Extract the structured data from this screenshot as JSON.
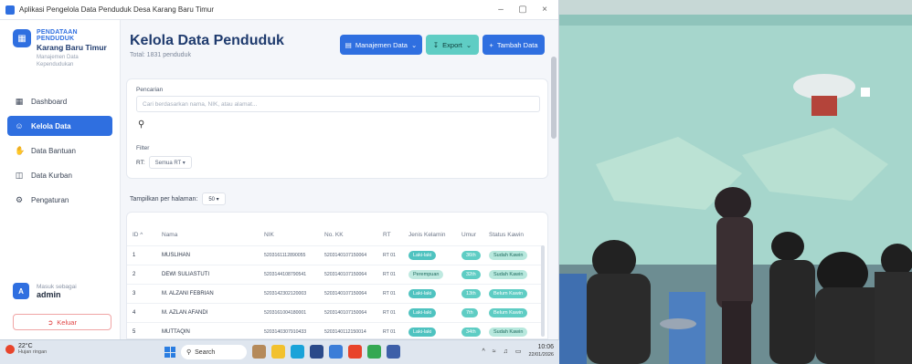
{
  "window": {
    "title": "Aplikasi Pengelola Data Penduduk Desa Karang Baru Timur",
    "minimize": "–",
    "maximize": "▢",
    "close": "×"
  },
  "sidebar": {
    "brand_kicker": "PENDATAAN PENDUDUK",
    "brand_name": "Karang Baru Timur",
    "brand_sub": "Manajemen Data Kependudukan",
    "items": [
      {
        "label": "Dashboard",
        "icon": "grid-icon",
        "active": false
      },
      {
        "label": "Kelola Data",
        "icon": "users-icon",
        "active": true
      },
      {
        "label": "Data Bantuan",
        "icon": "hand-icon",
        "active": false
      },
      {
        "label": "Data Kurban",
        "icon": "gift-icon",
        "active": false
      },
      {
        "label": "Pengaturan",
        "icon": "gear-icon",
        "active": false
      }
    ],
    "user_caption": "Masuk sebagai",
    "user_name": "admin",
    "avatar_letter": "A",
    "logout_label": "Keluar"
  },
  "header": {
    "title": "Kelola Data Penduduk",
    "subtitle": "Total: 1831 penduduk",
    "manage_label": "Manajemen Data",
    "export_label": "Export",
    "add_label": "Tambah Data"
  },
  "filters": {
    "search_label": "Pencarian",
    "search_placeholder": "Cari berdasarkan nama, NIK, atau alamat...",
    "filter_label": "Filter",
    "rt_label": "RT:",
    "rt_value": "Semua RT ▾",
    "perpage_label": "Tampilkan per halaman:",
    "perpage_value": "50 ▾"
  },
  "table": {
    "columns": [
      "ID ^",
      "Nama",
      "NIK",
      "No. KK",
      "RT",
      "Jenis Kelamin",
      "Umur",
      "Status Kawin"
    ],
    "rows": [
      {
        "id": "1",
        "nama": "MUSLIHAN",
        "nik": "5203161112890055",
        "kk": "5203140107150064",
        "rt": "RT 01",
        "jk": "Laki-laki",
        "umur": "36th",
        "status": "Sudah Kawin"
      },
      {
        "id": "2",
        "nama": "DEWI SULIASTUTI",
        "nik": "5203144108790541",
        "kk": "5203140107150064",
        "rt": "RT 01",
        "jk": "Perempuan",
        "umur": "32th",
        "status": "Sudah Kawin"
      },
      {
        "id": "3",
        "nama": "M. ALZANI FEBRIAN",
        "nik": "5203142302120003",
        "kk": "5203140107150064",
        "rt": "RT 01",
        "jk": "Laki-laki",
        "umur": "13th",
        "status": "Belum Kawin"
      },
      {
        "id": "4",
        "nama": "M. AZLAN AFANDI",
        "nik": "5203161004180001",
        "kk": "5203140107150064",
        "rt": "RT 01",
        "jk": "Laki-laki",
        "umur": "7th",
        "status": "Belum Kawin"
      },
      {
        "id": "5",
        "nama": "MUTTAQIN",
        "nik": "5203140307910433",
        "kk": "5203140112150014",
        "rt": "RT 01",
        "jk": "Laki-laki",
        "umur": "34th",
        "status": "Sudah Kawin"
      }
    ]
  },
  "taskbar": {
    "temp": "22°C",
    "weather": "Hujan ringan",
    "search_label": "Search",
    "time": "10:06",
    "date": "22/01/2026"
  },
  "colors": {
    "primary": "#2f6fe0",
    "teal": "#5fcdc4",
    "danger": "#e04444"
  }
}
